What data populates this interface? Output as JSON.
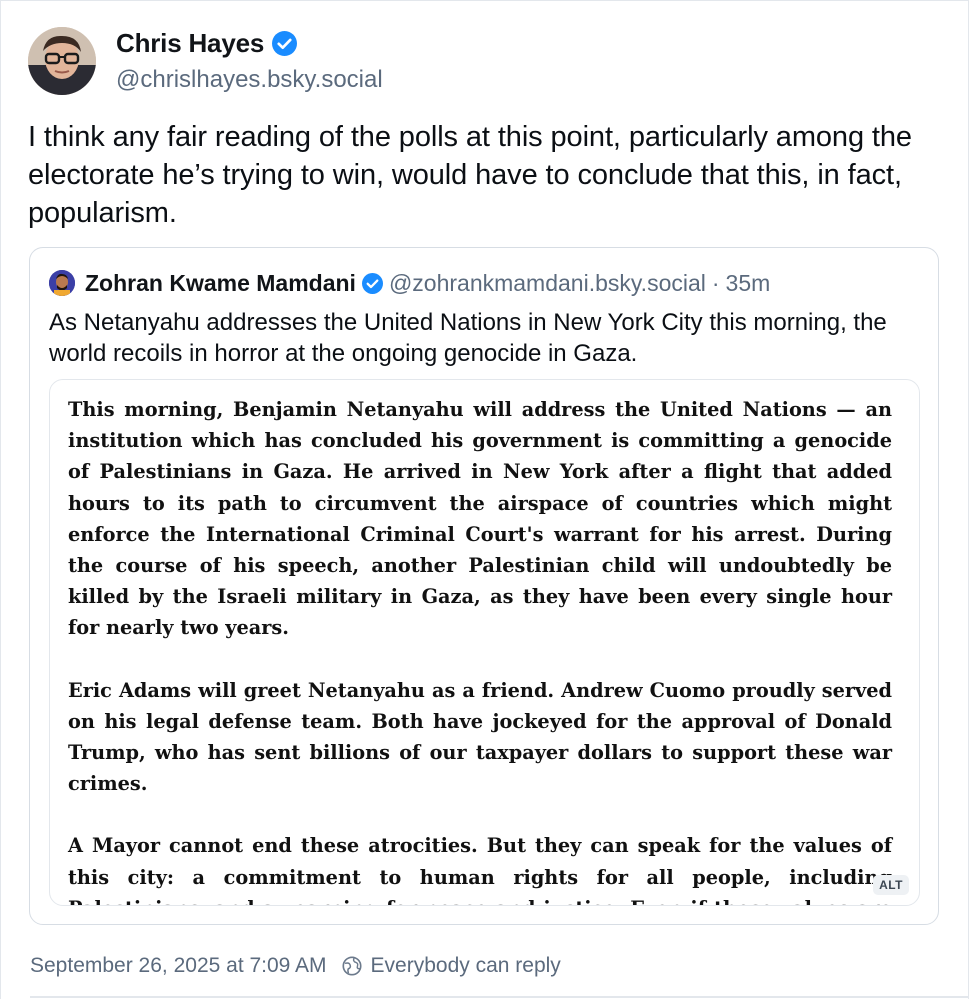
{
  "author": {
    "name": "Chris Hayes",
    "handle": "@chrislhayes.bsky.social",
    "verified_color": "#1a8cff"
  },
  "post": {
    "text": "I think any fair reading of the polls at this point, particularly among the electorate he’s trying to win, would have to conclude that this, in fact, popularism."
  },
  "quote": {
    "name": "Zohran Kwame Mamdani",
    "handle": "@zohrankmamdani.bsky.social",
    "separator": "·",
    "time": "35m",
    "text": "As Netanyahu addresses the United Nations in New York City this morning, the world recoils in horror at the ongoing genocide in Gaza.",
    "image": {
      "paragraphs": [
        "This morning, Benjamin Netanyahu will address the United Nations — an institution which has concluded his government is committing a genocide of Palestinians in Gaza. He arrived in New York after a flight that added hours to its path to circumvent the airspace of countries which might enforce the International Criminal Court's warrant for his arrest. During the course of his speech, another Palestinian child will undoubtedly be killed by the Israeli military in Gaza, as they have been every single hour for nearly two years.",
        "Eric Adams will greet Netanyahu as a friend. Andrew Cuomo proudly served on his legal defense team. Both have jockeyed for the approval of Donald Trump, who has sent billions of our taxpayer dollars to support these war crimes.",
        "A Mayor cannot end these atrocities. But they can speak for the values of this city: a commitment to human rights for all people, including Palestinians, and a yearning for peace and justice. Even if those values are anathema to those in power now, they will endure."
      ],
      "alt_label": "ALT"
    }
  },
  "meta": {
    "date": "September 26, 2025 at 7:09 AM",
    "reply_setting": "Everybody can reply",
    "reply_icon": "globe-icon"
  }
}
